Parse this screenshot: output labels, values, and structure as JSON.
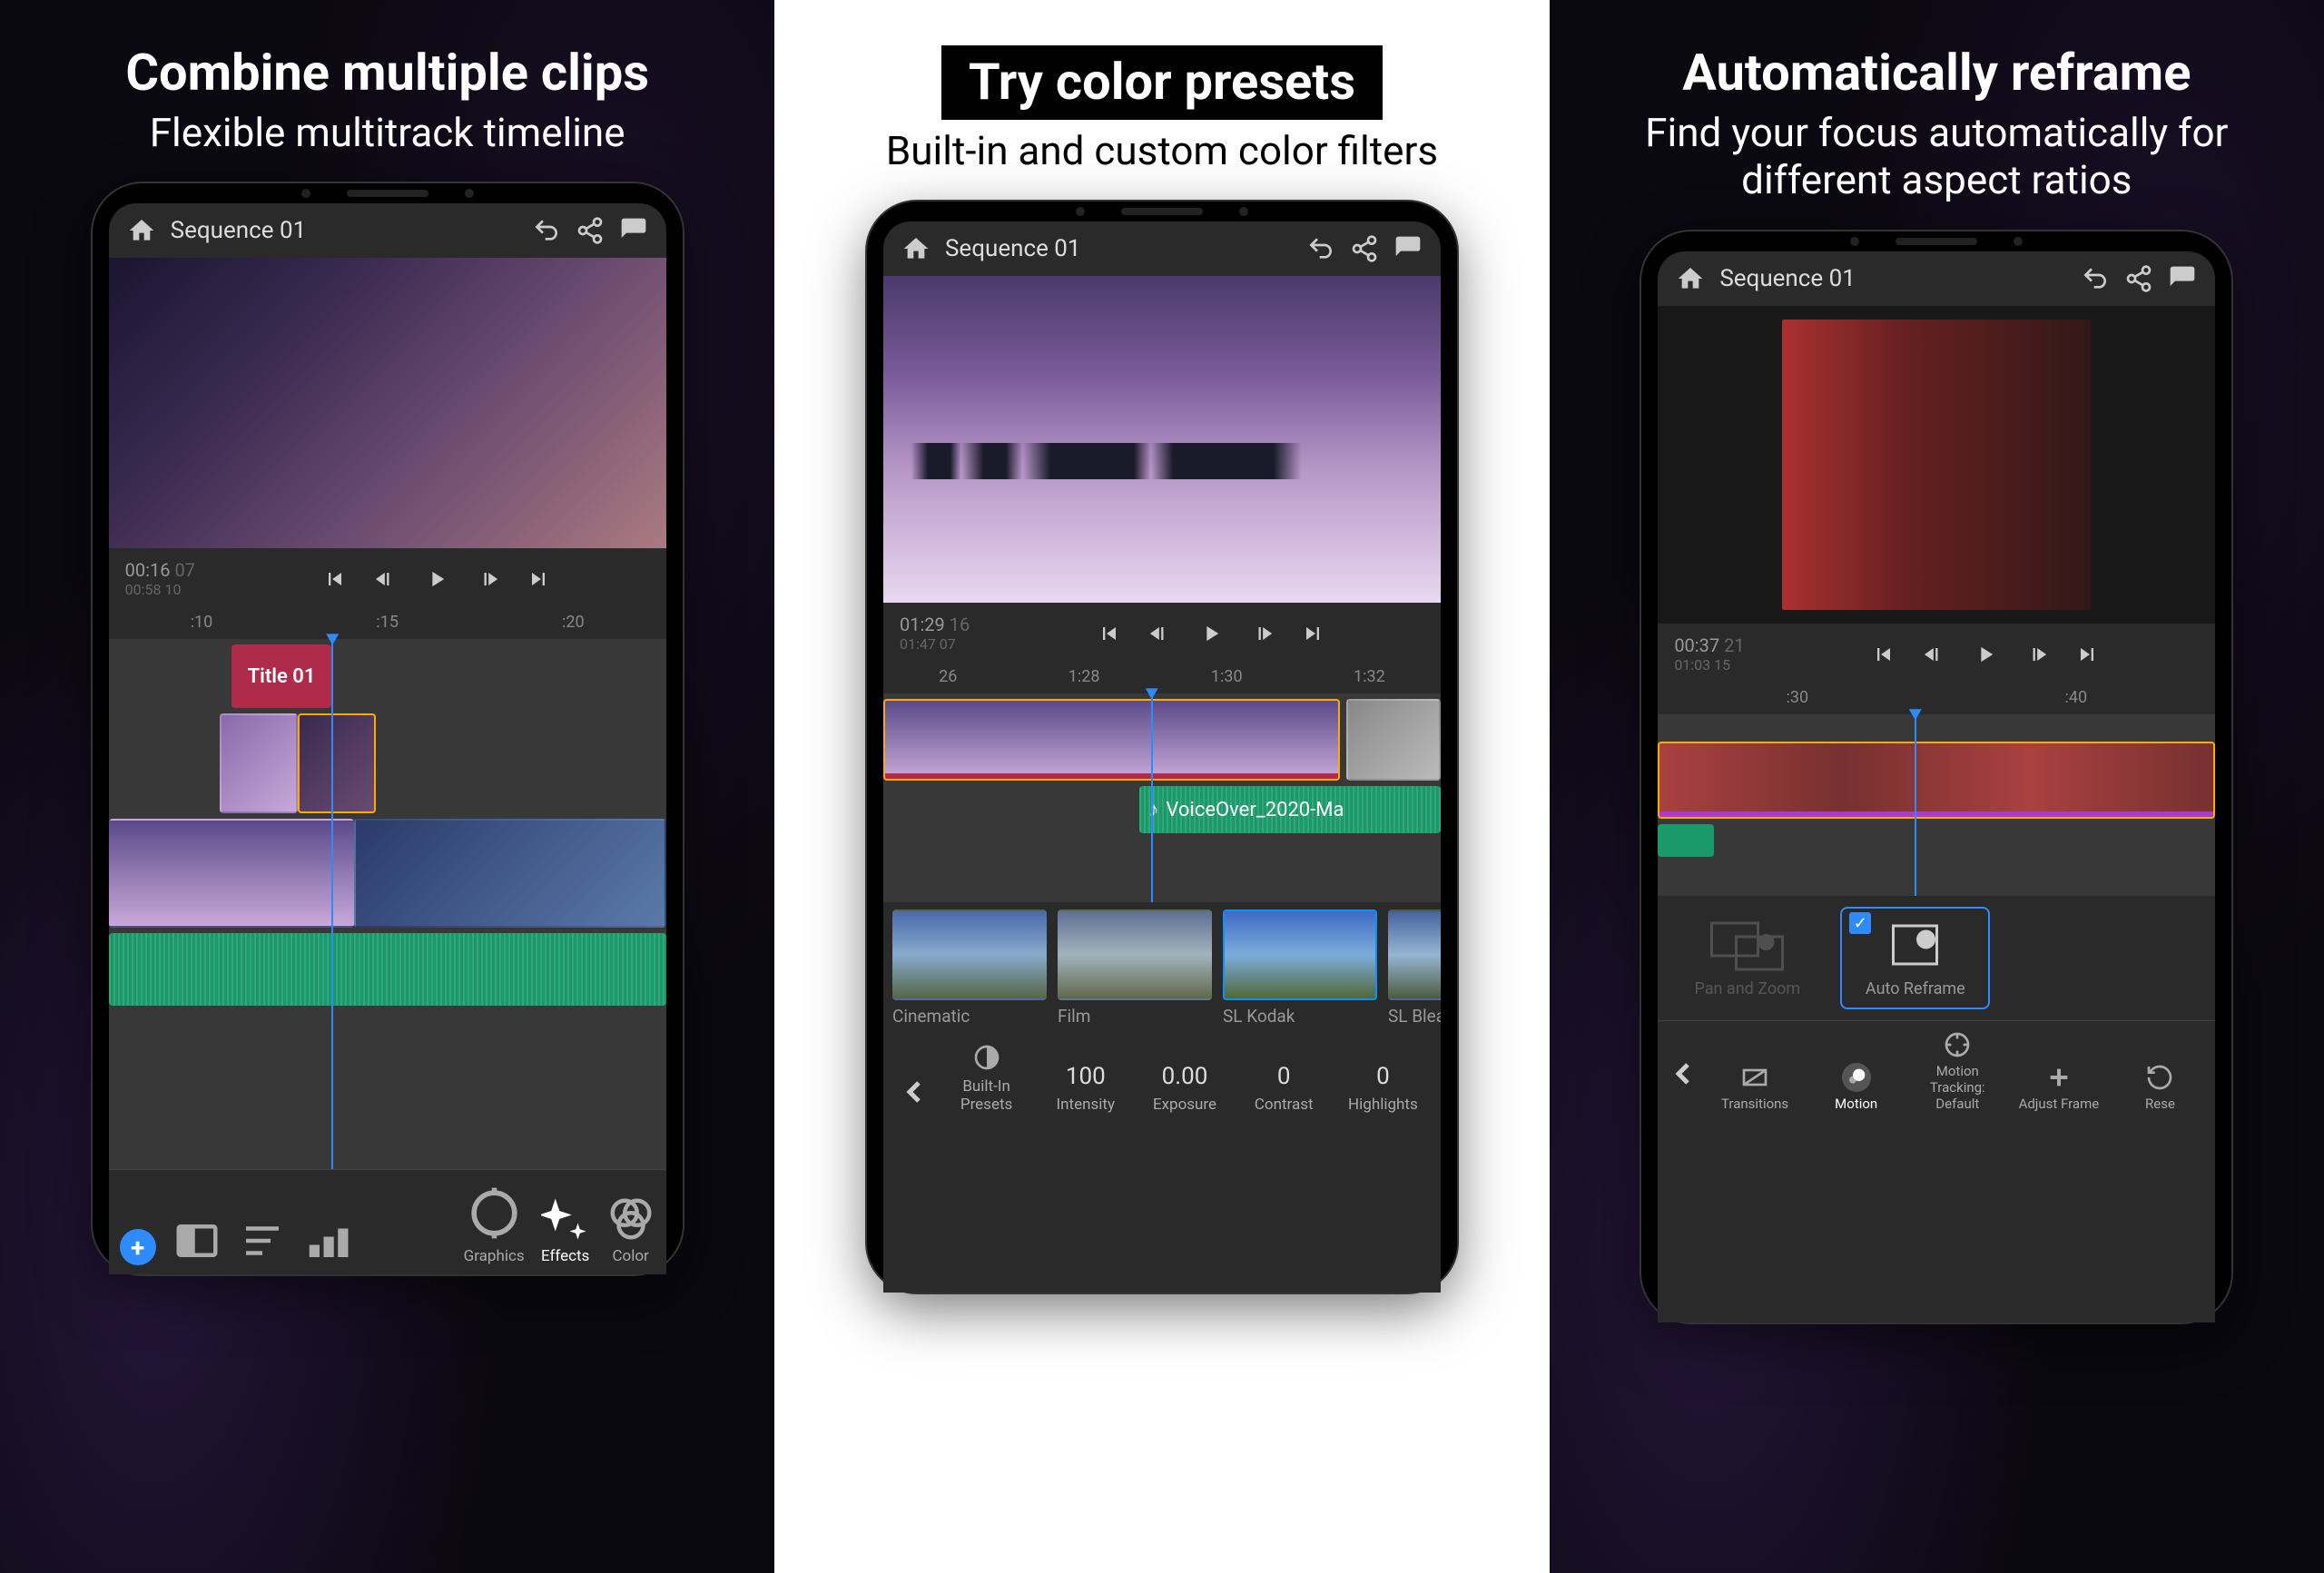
{
  "panels": {
    "a": {
      "title": "Combine multiple clips",
      "subtitle": "Flexible multitrack timeline",
      "header": {
        "sequence": "Sequence 01"
      },
      "timecode": {
        "main": "00:16",
        "main_fr": "07",
        "sub": "00:58",
        "sub_fr": "10"
      },
      "ruler": {
        "t1": ":10",
        "t2": ":15",
        "t3": ":20"
      },
      "title_clip": "Title 01",
      "bottom": {
        "graphics": "Graphics",
        "effects": "Effects",
        "color": "Color"
      }
    },
    "b": {
      "title": "Try color presets",
      "subtitle": "Built-in and custom color filters",
      "header": {
        "sequence": "Sequence 01"
      },
      "timecode": {
        "main": "01:29",
        "main_fr": "16",
        "sub": "01:47",
        "sub_fr": "07"
      },
      "ruler": {
        "t1": "26",
        "t2": "1:28",
        "t3": "1:30",
        "t4": "1:32"
      },
      "audio_clip": "VoiceOver_2020-Ma",
      "presets": {
        "p1": "Cinematic",
        "p2": "Film",
        "p3": "SL Kodak",
        "p4": "SL Bleac"
      },
      "controls": {
        "builtin": "Built-In Presets",
        "intensity_lbl": "Intensity",
        "intensity_val": "100",
        "exposure_lbl": "Exposure",
        "exposure_val": "0.00",
        "contrast_lbl": "Contrast",
        "contrast_val": "0",
        "highlights_lbl": "Highlights",
        "highlights_val": "0"
      }
    },
    "c": {
      "title": "Automatically reframe",
      "subtitle": "Find your focus automatically for different aspect ratios",
      "header": {
        "sequence": "Sequence 01"
      },
      "timecode": {
        "main": "00:37",
        "main_fr": "21",
        "sub": "01:03",
        "sub_fr": "15"
      },
      "ruler": {
        "t1": ":30",
        "t2": ":40"
      },
      "reframe": {
        "panzoom": "Pan and Zoom",
        "auto": "Auto Reframe"
      },
      "motion": {
        "transitions": "Transitions",
        "motion": "Motion",
        "tracking": "Motion Tracking: Default",
        "adjust": "Adjust Frame",
        "reset": "Rese"
      }
    }
  }
}
